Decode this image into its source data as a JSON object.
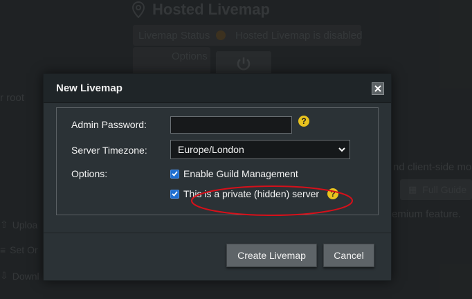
{
  "background": {
    "title": "Hosted Livemap",
    "status_label": "Livemap Status",
    "status_value": "Hosted Livemap is disabled",
    "options_label": "Options",
    "left_text": "r root",
    "right_text_1": "nd client-side mo",
    "full_guide_label": "Full Guide",
    "right_text_2": "emium feature.",
    "side_items": [
      "Uploa",
      "Set Or",
      "Downl"
    ]
  },
  "modal": {
    "title": "New Livemap",
    "fields": {
      "admin_password_label": "Admin Password:",
      "admin_password_value": "",
      "timezone_label": "Server Timezone:",
      "timezone_value": "Europe/London",
      "options_label": "Options:"
    },
    "options": [
      {
        "label": "Enable Guild Management",
        "checked": true
      },
      {
        "label": "This is a private (hidden) server",
        "checked": true
      }
    ],
    "help_glyph": "?",
    "buttons": {
      "create": "Create Livemap",
      "cancel": "Cancel"
    }
  },
  "colors": {
    "accent_blue": "#1f6fd1",
    "help_yellow": "#e8c21e",
    "annotation_red": "#d6101a"
  }
}
